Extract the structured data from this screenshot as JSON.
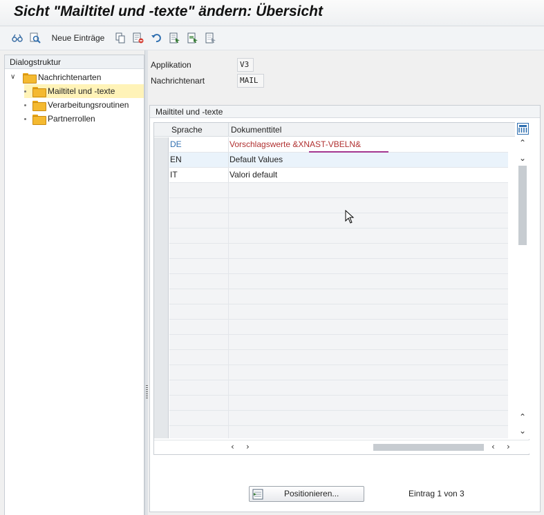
{
  "window": {
    "title": "Sicht \"Mailtitel und -texte\" ändern: Übersicht"
  },
  "toolbar": {
    "items": [
      {
        "icon": "glasses-icon"
      },
      {
        "icon": "find-icon"
      },
      {
        "label": "Neue Einträge"
      },
      {
        "icon": "copy-icon"
      },
      {
        "icon": "delete-icon"
      },
      {
        "icon": "undo-icon"
      },
      {
        "icon": "select-all-icon"
      },
      {
        "icon": "select-block-icon"
      },
      {
        "icon": "deselect-all-icon"
      }
    ]
  },
  "sidebar": {
    "header": "Dialogstruktur",
    "tree": [
      {
        "label": "Nachrichtenarten",
        "level": 0,
        "expanded": true
      },
      {
        "label": "Mailtitel und -texte",
        "level": 1,
        "selected": true
      },
      {
        "label": "Verarbeitungsroutinen",
        "level": 1
      },
      {
        "label": "Partnerrollen",
        "level": 1
      }
    ]
  },
  "header_fields": {
    "application": {
      "label": "Applikation",
      "value": "V3"
    },
    "message_type": {
      "label": "Nachrichtenart",
      "value": "MAIL"
    }
  },
  "group": {
    "title": "Mailtitel und -texte",
    "columns": [
      "Sprache",
      "Dokumenttitel"
    ],
    "rows": [
      {
        "lang": "DE",
        "title": "Vorschlagswerte &XNAST-VBELN&"
      },
      {
        "lang": "EN",
        "title": "Default Values"
      },
      {
        "lang": "IT",
        "title": "Valori default"
      }
    ]
  },
  "footer": {
    "position_button": "Positionieren...",
    "entry_info": "Eintrag 1 von 3"
  },
  "colors": {
    "highlight_border": "#a3358f",
    "de_text": "#b03030",
    "folder": "#f4b930"
  }
}
